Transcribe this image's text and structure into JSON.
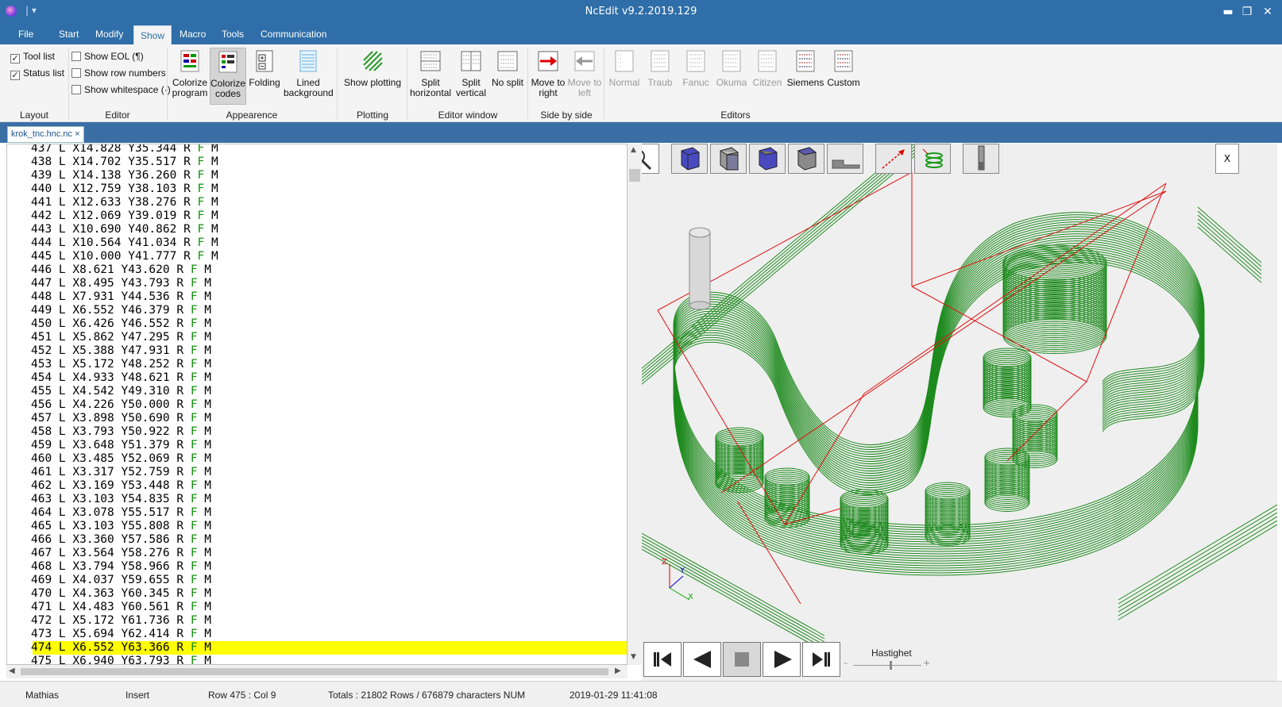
{
  "window": {
    "title": "NcEdit v9.2.2019.129",
    "quick_access": "|   ▾"
  },
  "menu": {
    "file": "File",
    "start": "Start",
    "modify": "Modify",
    "show": "Show",
    "macro": "Macro",
    "tools": "Tools",
    "communication": "Communication"
  },
  "ribbon": {
    "layout": {
      "label": "Layout",
      "tool_list": "Tool list",
      "status_list": "Status list",
      "tool_list_checked": true,
      "status_list_checked": true
    },
    "editor": {
      "label": "Editor",
      "show_eol": "Show EOL (¶)",
      "show_row_numbers": "Show row numbers",
      "show_whitespace": "Show whitespace (·)"
    },
    "appearance": {
      "label": "Appearence",
      "colorize_program_1": "Colorize",
      "colorize_program_2": "program",
      "colorize_codes_1": "Colorize",
      "colorize_codes_2": "codes",
      "folding": "Folding",
      "lined_background_1": "Lined",
      "lined_background_2": "background"
    },
    "plotting": {
      "label": "Plotting",
      "show_plotting": "Show plotting"
    },
    "editor_window": {
      "label": "Editor window",
      "split_horizontal_1": "Split",
      "split_horizontal_2": "horizontal",
      "split_vertical_1": "Split",
      "split_vertical_2": "vertical",
      "no_split": "No split"
    },
    "side_by_side": {
      "label": "Side by side",
      "move_right_1": "Move to",
      "move_right_2": "right",
      "move_left_1": "Move to",
      "move_left_2": "left"
    },
    "editors": {
      "label": "Editors",
      "normal": "Normal",
      "traub": "Traub",
      "fanuc": "Fanuc",
      "okuma": "Okuma",
      "citizen": "Citizen",
      "siemens": "Siemens",
      "custom": "Custom"
    }
  },
  "file_tab": {
    "name": "krok_tnc.hnc.nc",
    "close": "×"
  },
  "code_lines": [
    {
      "n": "437",
      "x": "X14.828",
      "y": "Y35.344"
    },
    {
      "n": "438",
      "x": "X14.702",
      "y": "Y35.517"
    },
    {
      "n": "439",
      "x": "X14.138",
      "y": "Y36.260"
    },
    {
      "n": "440",
      "x": "X12.759",
      "y": "Y38.103"
    },
    {
      "n": "441",
      "x": "X12.633",
      "y": "Y38.276"
    },
    {
      "n": "442",
      "x": "X12.069",
      "y": "Y39.019"
    },
    {
      "n": "443",
      "x": "X10.690",
      "y": "Y40.862"
    },
    {
      "n": "444",
      "x": "X10.564",
      "y": "Y41.034"
    },
    {
      "n": "445",
      "x": "X10.000",
      "y": "Y41.777"
    },
    {
      "n": "446",
      "x": "X8.621",
      "y": "Y43.620"
    },
    {
      "n": "447",
      "x": "X8.495",
      "y": "Y43.793"
    },
    {
      "n": "448",
      "x": "X7.931",
      "y": "Y44.536"
    },
    {
      "n": "449",
      "x": "X6.552",
      "y": "Y46.379"
    },
    {
      "n": "450",
      "x": "X6.426",
      "y": "Y46.552"
    },
    {
      "n": "451",
      "x": "X5.862",
      "y": "Y47.295"
    },
    {
      "n": "452",
      "x": "X5.388",
      "y": "Y47.931"
    },
    {
      "n": "453",
      "x": "X5.172",
      "y": "Y48.252"
    },
    {
      "n": "454",
      "x": "X4.933",
      "y": "Y48.621"
    },
    {
      "n": "455",
      "x": "X4.542",
      "y": "Y49.310"
    },
    {
      "n": "456",
      "x": "X4.226",
      "y": "Y50.000"
    },
    {
      "n": "457",
      "x": "X3.898",
      "y": "Y50.690"
    },
    {
      "n": "458",
      "x": "X3.793",
      "y": "Y50.922"
    },
    {
      "n": "459",
      "x": "X3.648",
      "y": "Y51.379"
    },
    {
      "n": "460",
      "x": "X3.485",
      "y": "Y52.069"
    },
    {
      "n": "461",
      "x": "X3.317",
      "y": "Y52.759"
    },
    {
      "n": "462",
      "x": "X3.169",
      "y": "Y53.448"
    },
    {
      "n": "463",
      "x": "X3.103",
      "y": "Y54.835"
    },
    {
      "n": "464",
      "x": "X3.078",
      "y": "Y55.517"
    },
    {
      "n": "465",
      "x": "X3.103",
      "y": "Y55.808"
    },
    {
      "n": "466",
      "x": "X3.360",
      "y": "Y57.586"
    },
    {
      "n": "467",
      "x": "X3.564",
      "y": "Y58.276"
    },
    {
      "n": "468",
      "x": "X3.794",
      "y": "Y58.966"
    },
    {
      "n": "469",
      "x": "X4.037",
      "y": "Y59.655"
    },
    {
      "n": "470",
      "x": "X4.363",
      "y": "Y60.345"
    },
    {
      "n": "471",
      "x": "X4.483",
      "y": "Y60.561"
    },
    {
      "n": "472",
      "x": "X5.172",
      "y": "Y61.736"
    },
    {
      "n": "473",
      "x": "X5.694",
      "y": "Y62.414"
    },
    {
      "n": "474",
      "x": "X6.552",
      "y": "Y63.366"
    },
    {
      "n": "475",
      "x": "X6.940",
      "y": "Y63.793"
    }
  ],
  "code_tokens": {
    "l": "L",
    "r": "R",
    "f": "F",
    "m": "M"
  },
  "highlight_line": "474",
  "viewer": {
    "close": "X",
    "speed_label": "Hastighet",
    "minus": "–",
    "plus": "+",
    "axis_x": "X",
    "axis_y": "Y",
    "axis_z": "Z"
  },
  "status": {
    "user": "Mathias",
    "mode": "Insert",
    "position": "Row 475 : Col 9",
    "totals": "Totals : 21802 Rows / 676879 characters NUM",
    "datetime": "2019-01-29 11:41:08"
  },
  "colors": {
    "titlebar": "#2f6ea8",
    "toolpath": "#1d8a1d",
    "rapid": "#e01010",
    "highlight": "#ffff00"
  }
}
